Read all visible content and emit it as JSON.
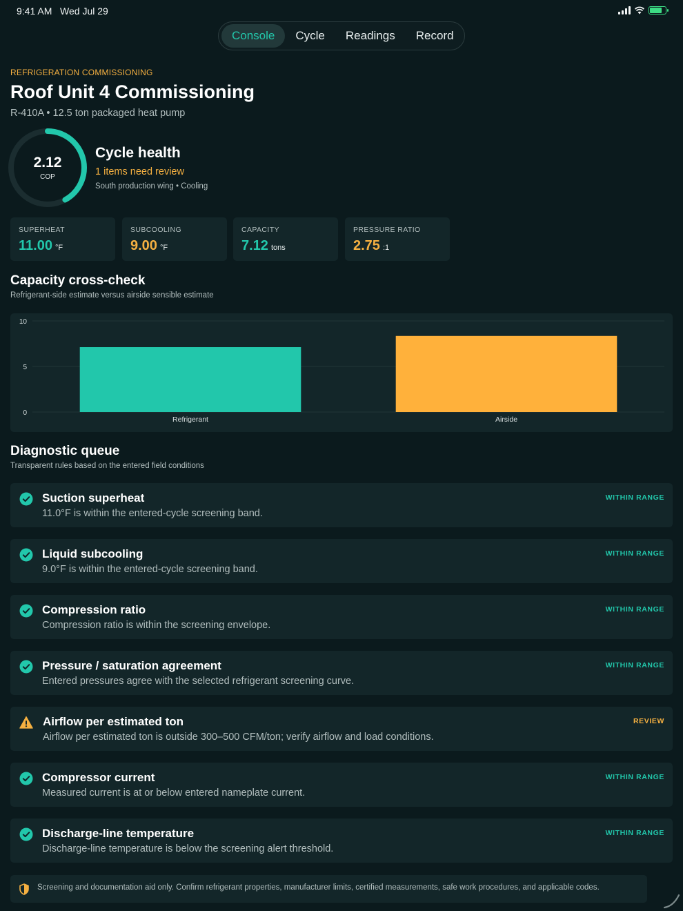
{
  "status": {
    "time": "9:41 AM",
    "date": "Wed Jul 29",
    "battery_level": 0.8
  },
  "tabs": [
    "Console",
    "Cycle",
    "Readings",
    "Record"
  ],
  "active_tab": "Console",
  "header": {
    "eyebrow": "REFRIGERATION COMMISSIONING",
    "title": "Roof Unit 4 Commissioning",
    "subtitle": "R-410A • 12.5 ton packaged heat pump"
  },
  "health": {
    "cop_value": "2.12",
    "cop_label": "COP",
    "gauge_fraction": 0.42,
    "title": "Cycle health",
    "review": "1 items need review",
    "meta": "South production wing • Cooling"
  },
  "metrics": [
    {
      "label": "SUPERHEAT",
      "value": "11.00",
      "unit": "°F",
      "color": "#22c7ab"
    },
    {
      "label": "SUBCOOLING",
      "value": "9.00",
      "unit": "°F",
      "color": "#f5b041"
    },
    {
      "label": "CAPACITY",
      "value": "7.12",
      "unit": "tons",
      "color": "#22c7ab"
    },
    {
      "label": "PRESSURE RATIO",
      "value": "2.75",
      "unit": ":1",
      "color": "#f5b041"
    }
  ],
  "capacity_section": {
    "title": "Capacity cross-check",
    "subtitle": "Refrigerant-side estimate versus airside sensible estimate"
  },
  "chart_data": {
    "type": "bar",
    "categories": [
      "Refrigerant",
      "Airside"
    ],
    "values": [
      7.12,
      8.35
    ],
    "colors": [
      "#22c7ab",
      "#ffb13b"
    ],
    "yticks": [
      0,
      5,
      10
    ],
    "ylim": [
      0,
      10
    ],
    "grid": true,
    "legend": "none"
  },
  "diagnostic_section": {
    "title": "Diagnostic queue",
    "subtitle": "Transparent rules based on the entered field conditions"
  },
  "diagnostics": [
    {
      "title": "Suction superheat",
      "desc": "11.0°F is within the entered-cycle screening band.",
      "status": "WITHIN RANGE",
      "state": "ok"
    },
    {
      "title": "Liquid subcooling",
      "desc": "9.0°F is within the entered-cycle screening band.",
      "status": "WITHIN RANGE",
      "state": "ok"
    },
    {
      "title": "Compression ratio",
      "desc": "Compression ratio is within the screening envelope.",
      "status": "WITHIN RANGE",
      "state": "ok"
    },
    {
      "title": "Pressure / saturation agreement",
      "desc": "Entered pressures agree with the selected refrigerant screening curve.",
      "status": "WITHIN RANGE",
      "state": "ok"
    },
    {
      "title": "Airflow per estimated ton",
      "desc": "Airflow per estimated ton is outside 300–500 CFM/ton; verify airflow and load conditions.",
      "status": "REVIEW",
      "state": "warn"
    },
    {
      "title": "Compressor current",
      "desc": "Measured current is at or below entered nameplate current.",
      "status": "WITHIN RANGE",
      "state": "ok"
    },
    {
      "title": "Discharge-line temperature",
      "desc": "Discharge-line temperature is below the screening alert threshold.",
      "status": "WITHIN RANGE",
      "state": "ok"
    }
  ],
  "footer": {
    "note": "Screening and documentation aid only. Confirm refrigerant properties, manufacturer limits, certified measurements, safe work procedures, and applicable codes."
  },
  "colors": {
    "accent": "#22c7ab",
    "warning": "#f5b041",
    "background": "#0b1a1d",
    "card": "#132629"
  }
}
